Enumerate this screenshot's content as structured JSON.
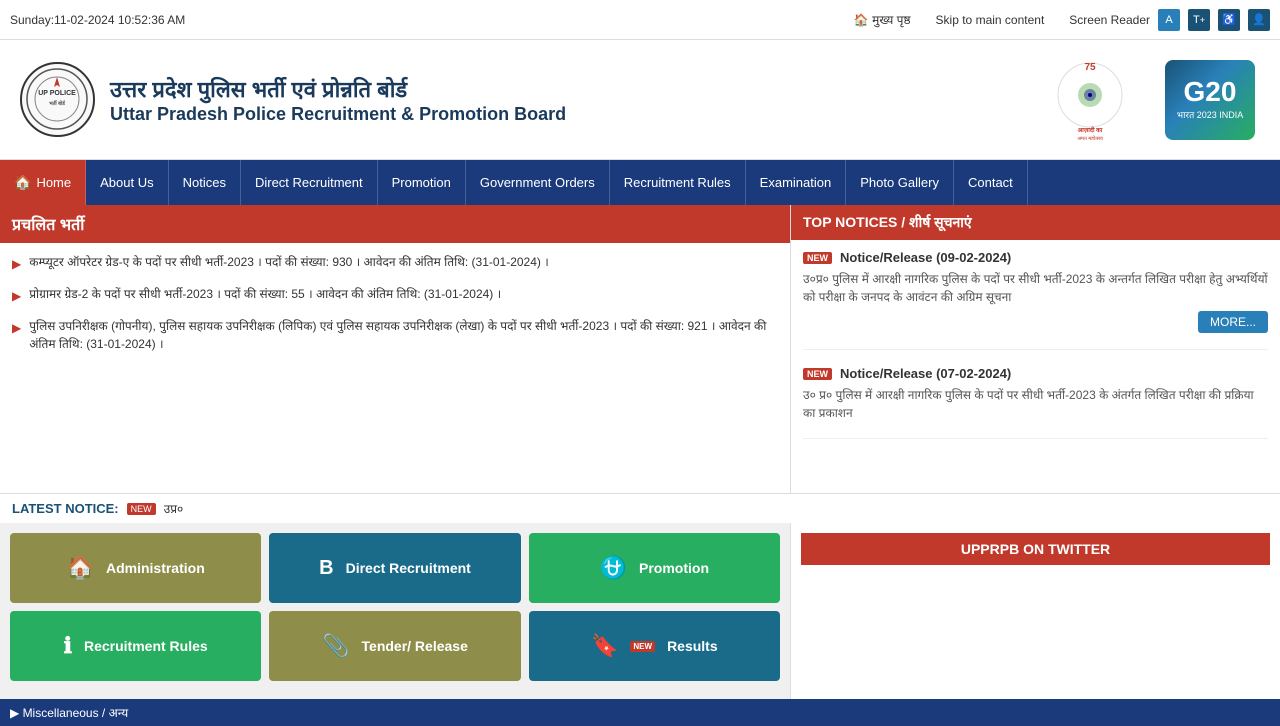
{
  "topbar": {
    "datetime": "Sunday:11-02-2024 10:52:36 AM",
    "home_icon": "🏠",
    "home_label": "मुख्य पृष्ठ",
    "skip_label": "Skip to main content",
    "screen_reader": "Screen Reader",
    "font_increase": "T↑",
    "accessibility_icon": "♿",
    "admin_icon": "👤"
  },
  "header": {
    "title_hi": "उत्तर प्रदेश पुलिस भर्ती एवं प्रोन्नति बोर्ड",
    "title_en": "Uttar Pradesh Police Recruitment & Promotion Board",
    "logo_text": "UP Police",
    "azadi_text": "आज़ादी का अमृत महोत्सव",
    "g20_text": "G20"
  },
  "nav": {
    "items": [
      {
        "id": "home",
        "label": "Home",
        "active": true
      },
      {
        "id": "about",
        "label": "About Us",
        "active": false
      },
      {
        "id": "notices",
        "label": "Notices",
        "active": false
      },
      {
        "id": "direct-recruitment",
        "label": "Direct Recruitment",
        "active": false
      },
      {
        "id": "promotion",
        "label": "Promotion",
        "active": false
      },
      {
        "id": "government-orders",
        "label": "Government Orders",
        "active": false
      },
      {
        "id": "recruitment-rules",
        "label": "Recruitment Rules",
        "active": false
      },
      {
        "id": "examination",
        "label": "Examination",
        "active": false
      },
      {
        "id": "photo-gallery",
        "label": "Photo Gallery",
        "active": false
      },
      {
        "id": "contact",
        "label": "Contact",
        "active": false
      }
    ]
  },
  "pravrit": {
    "header": "प्रचलित भर्ती",
    "items": [
      {
        "text": "कम्प्यूटर ऑपरेटर ग्रेड-ए के पदों पर सीधी भर्ती-2023 । पदों की संख्या: 930 । आवेदन की अंतिम तिथि: (31-01-2024) ।"
      },
      {
        "text": "प्रोग्रामर ग्रेड-2 के पदों पर सीधी भर्ती-2023 । पदों की संख्या: 55 । आवेदन की अंतिम तिथि: (31-01-2024) ।"
      },
      {
        "text": "पुलिस उपनिरीक्षक (गोपनीय), पुलिस सहायक उपनिरीक्षक (लिपिक) एवं पुलिस सहायक उपनिरीक्षक (लेखा) के पदों पर सीधी भर्ती-2023 । पदों की संख्या: 921 । आवेदन की अंतिम तिथि: (31-01-2024) ।"
      }
    ]
  },
  "notices": {
    "header": "TOP NOTICES / शीर्ष सूचनाएं",
    "items": [
      {
        "date": "Notice/Release (09-02-2024)",
        "body": "उ०प्र० पुलिस में आरक्षी नागरिक पुलिस के पदों पर सीधी भर्ती-2023 के अन्तर्गत लिखित परीक्षा हेतु अभ्यर्थियों को परीक्षा के जनपद के आवंटन की अग्रिम सूचना",
        "has_more": true,
        "more_label": "MORE..."
      },
      {
        "date": "Notice/Release (07-02-2024)",
        "body": "उ० प्र० पुलिस में आरक्षी नागरिक पुलिस के पदों पर सीधी भर्ती-2023 के अंतर्गत लिखित परीक्षा की प्रक्रिया का प्रकाशन",
        "has_more": false
      }
    ]
  },
  "latest_notice": {
    "label": "LATEST NOTICE:",
    "text": "उप्र०"
  },
  "tiles": {
    "items": [
      {
        "id": "administration",
        "label": "Administration",
        "icon": "🏠",
        "color": "olive"
      },
      {
        "id": "direct-recruitment",
        "label": "Direct Recruitment",
        "icon": "B",
        "color": "blue-dark"
      },
      {
        "id": "promotion",
        "label": "Promotion",
        "icon": "♐",
        "color": "green"
      },
      {
        "id": "recruitment-rules",
        "label": "Recruitment Rules",
        "icon": "ℹ",
        "color": "green"
      },
      {
        "id": "tender-release",
        "label": "Tender/ Release",
        "icon": "🔗",
        "color": "olive"
      },
      {
        "id": "results",
        "label": "Results",
        "icon": "🔖",
        "color": "blue-dark"
      }
    ]
  },
  "twitter": {
    "header": "UPPRPB ON TWITTER"
  },
  "misc": {
    "label": "▶ Miscellaneous / अन्य"
  }
}
